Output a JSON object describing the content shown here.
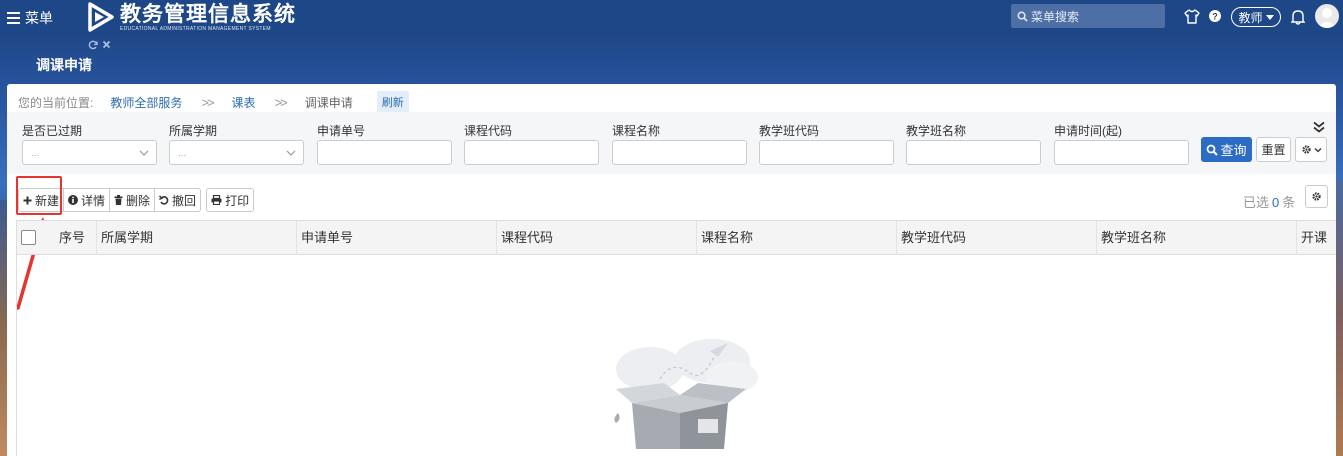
{
  "topbar": {
    "menu_label": "菜单",
    "logo_title": "教务管理信息系统",
    "logo_subtitle": "EDUCATIONAL ADMINISTRATION MANAGEMENT SYSTEM",
    "search_placeholder": "菜单搜索",
    "role_label": "教师"
  },
  "tab": {
    "title": "调课申请"
  },
  "breadcrumb": {
    "prefix": "您的当前位置:",
    "items": [
      "教师全部服务",
      "课表",
      "调课申请"
    ],
    "refresh_label": "刷新"
  },
  "filters": {
    "fields": [
      {
        "label": "是否已过期",
        "type": "select",
        "value": "..."
      },
      {
        "label": "所属学期",
        "type": "select",
        "value": "..."
      },
      {
        "label": "申请单号",
        "type": "input",
        "value": ""
      },
      {
        "label": "课程代码",
        "type": "input",
        "value": ""
      },
      {
        "label": "课程名称",
        "type": "input",
        "value": ""
      },
      {
        "label": "教学班代码",
        "type": "input",
        "value": ""
      },
      {
        "label": "教学班名称",
        "type": "input",
        "value": ""
      },
      {
        "label": "申请时间(起)",
        "type": "input",
        "value": ""
      }
    ],
    "query_label": "查询",
    "reset_label": "重置"
  },
  "toolbar": {
    "new_label": "新建",
    "detail_label": "详情",
    "delete_label": "删除",
    "revoke_label": "撤回",
    "print_label": "打印",
    "selected_prefix": "已选",
    "selected_count": "0",
    "selected_suffix": "条"
  },
  "grid": {
    "columns": [
      "序号",
      "所属学期",
      "申请单号",
      "课程代码",
      "课程名称",
      "教学班代码",
      "教学班名称",
      "开课"
    ]
  },
  "colors": {
    "topbar": "#1e4788",
    "accent": "#2c6cc4",
    "highlight": "#e53530"
  }
}
